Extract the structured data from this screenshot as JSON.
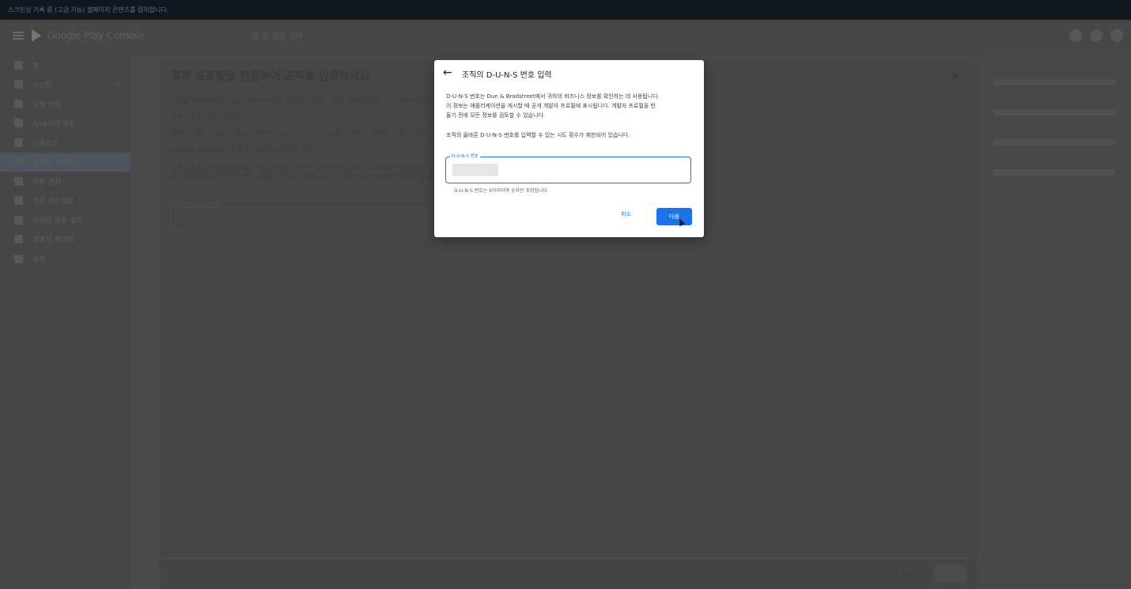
{
  "topbar": {
    "text": "스크린샷 기록 중 (고급 기능) 웹페이지 콘텐츠를 캡처합니다."
  },
  "app": {
    "title": "Google Play Console",
    "search_text": "앱 및 설정 검색"
  },
  "sidebar": {
    "items": [
      {
        "label": "홈"
      },
      {
        "label": "수신함",
        "badge": "10"
      },
      {
        "label": "정책 상태"
      },
      {
        "label": "Android 경험"
      },
      {
        "label": "다운로드"
      },
      {
        "label": "사용자 및 권한"
      },
      {
        "label": "주문 관리"
      },
      {
        "label": "계정 세부정보"
      },
      {
        "label": "이메일 알림 설정"
      },
      {
        "label": "개발자 페이지"
      },
      {
        "label": "설정"
      }
    ]
  },
  "dialog1": {
    "title": "결제 프로필을 연결하여 조직을 인증하세요",
    "lines": [
      "조직을 인증하려면 Google 결제 프로필을 연결해야 합니다. 결제 프로필이 없는 경우 결제 프로필",
      "결제 프로필이란 무엇인가요?",
      "결제 프로필은 Google 제품 전반에서 사용되며, 비즈니스 정보를 한곳에서 관리할 수 있어 시간이",
      "Google Play에서 결제 프로필을 사용하는 방식",
      "결제 프로필은 Play Console 개발자 계정을 인증하는 데 매우 중요합니다. Google Play에서는",
      "N-S 번호를 포함한 조직에 관한 정보를 수집하고 인증합니다. 이 정보는 최신 상태로 유지해야 합니다"
    ],
    "field_label": "결제 프로필 ID 선택",
    "footer_close": "닫기"
  },
  "modal": {
    "title": "조직의 D-U-N-S 번호 입력",
    "body": [
      "D-U-N-S 번호는 Dun & Bradstreet에서 귀하의 비즈니스 정보를 확인하는 데 사용됩니다.",
      "이 정보는 애플리케이션을 게시할 때 공개 개발자 프로필에 표시됩니다. 개발자 프로필을 만",
      "들기 전에 모든 정보를 검토할 수 있습니다."
    ],
    "note": "조직의 올바른 D-U-N-S 번호를 입력할 수 있는 시도 횟수가 제한되어 있습니다.",
    "field_label": "D-U-N-S 번호",
    "field_value": "",
    "helper": "D-U-N-S 번호는 9자리이며 숫자만 포함됩니다.",
    "cancel": "취소",
    "next": "다음"
  },
  "colors": {
    "accent": "#1a73e8",
    "scrim": "#3a3a3a"
  }
}
